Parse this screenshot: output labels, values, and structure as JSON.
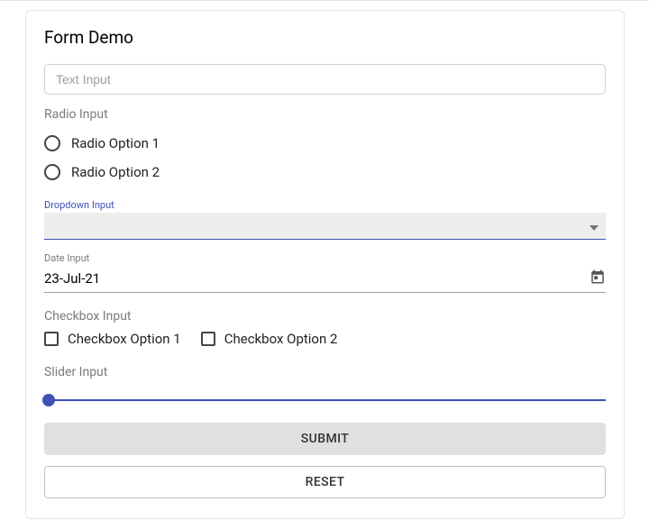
{
  "title": "Form Demo",
  "text_input": {
    "placeholder": "Text Input",
    "value": ""
  },
  "radio": {
    "label": "Radio Input",
    "options": [
      "Radio Option 1",
      "Radio Option 2"
    ]
  },
  "dropdown": {
    "label": "Dropdown Input",
    "value": ""
  },
  "date": {
    "label": "Date Input",
    "value": "23-Jul-21"
  },
  "checkbox": {
    "label": "Checkbox Input",
    "options": [
      "Checkbox Option 1",
      "Checkbox Option 2"
    ]
  },
  "slider": {
    "label": "Slider Input",
    "value": 0
  },
  "buttons": {
    "submit": "SUBMIT",
    "reset": "RESET"
  }
}
